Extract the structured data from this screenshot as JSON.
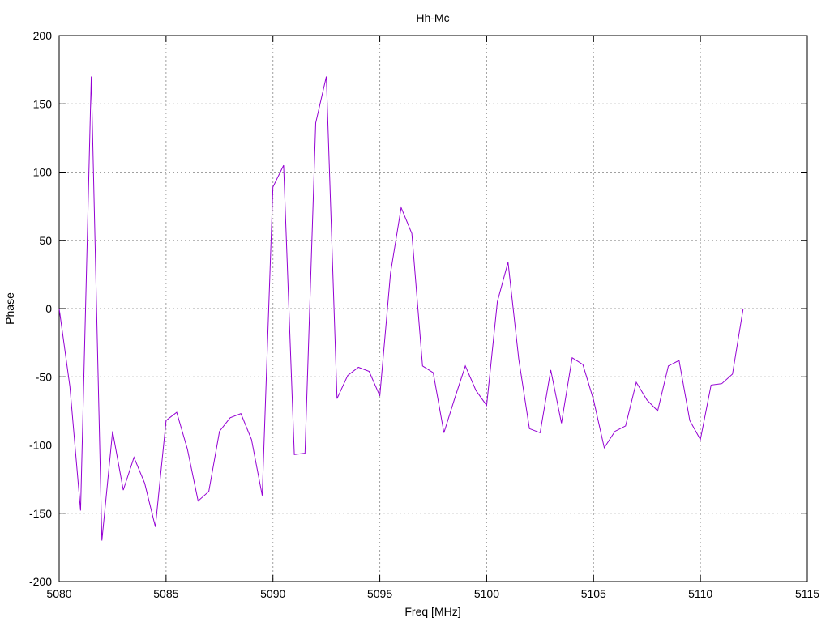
{
  "chart_data": {
    "type": "line",
    "title": "Hh-Mc",
    "xlabel": "Freq [MHz]",
    "ylabel": "Phase",
    "xlim": [
      5080,
      5115
    ],
    "ylim": [
      -200,
      200
    ],
    "xticks": [
      5080,
      5085,
      5090,
      5095,
      5100,
      5105,
      5110,
      5115
    ],
    "yticks": [
      -200,
      -150,
      -100,
      -50,
      0,
      50,
      100,
      150,
      200
    ],
    "grid": true,
    "line_color": "#9400d3",
    "series": [
      {
        "x": [
          5080,
          5080.5,
          5081,
          5081.5,
          5082,
          5082.5,
          5083,
          5083.5,
          5084,
          5084.5,
          5085,
          5085.5,
          5086,
          5086.5,
          5087,
          5087.5,
          5088,
          5088.5,
          5089,
          5089.5,
          5090,
          5090.5,
          5091,
          5091.5,
          5092,
          5092.5,
          5093,
          5093.5,
          5094,
          5094.5,
          5095,
          5095.5,
          5096,
          5096.5,
          5097,
          5097.5,
          5098,
          5098.5,
          5099,
          5099.5,
          5100,
          5100.5,
          5101,
          5101.5,
          5102,
          5102.5,
          5103,
          5103.5,
          5104,
          5104.5,
          5105,
          5105.5,
          5106,
          5106.5,
          5107,
          5107.5,
          5108,
          5108.5,
          5109,
          5109.5,
          5110,
          5110.5,
          5111,
          5111.5,
          5112
        ],
        "y": [
          0,
          -57,
          -148,
          170,
          -170,
          -90,
          -133,
          -109,
          -128,
          -160,
          -82,
          -76,
          -103,
          -141,
          -134,
          -90,
          -80,
          -77,
          -96,
          -137,
          89,
          105,
          -107,
          -106,
          136,
          170,
          -66,
          -49,
          -43,
          -46,
          -64,
          26,
          74,
          55,
          -42,
          -47,
          -91,
          -66,
          -42,
          -60,
          -71,
          5,
          34,
          -37,
          -88,
          -91,
          -45,
          -84,
          -36,
          -41,
          -67,
          -102,
          -90,
          -86,
          -54,
          -67,
          -75,
          -42,
          -38,
          -82,
          -96,
          -56,
          -55,
          -48,
          0
        ]
      }
    ]
  }
}
